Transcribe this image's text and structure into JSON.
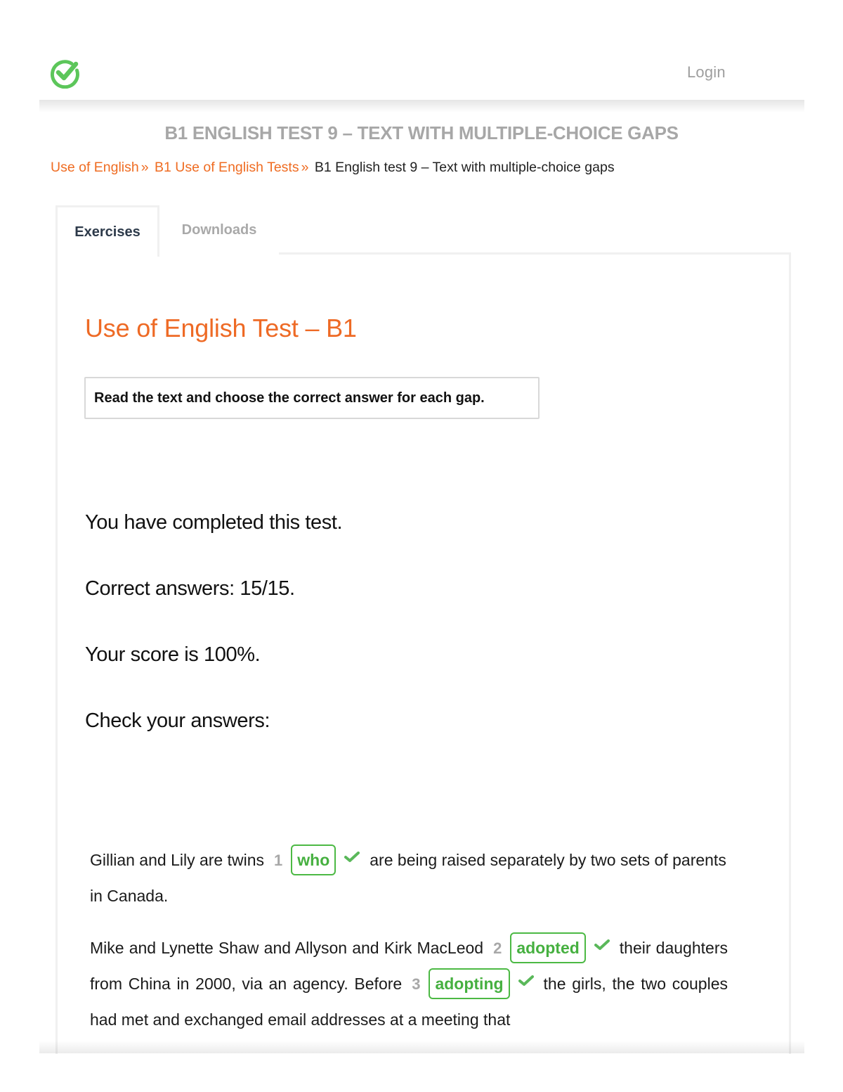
{
  "header": {
    "logo_icon": "check-circle-icon",
    "login_label": "Login",
    "brand_color": "#5cc65a"
  },
  "page_title": "B1 ENGLISH TEST 9 – TEXT WITH MULTIPLE-CHOICE GAPS",
  "breadcrumb": {
    "items": [
      {
        "label": "Use of English",
        "link": true
      },
      {
        "label": "B1 Use of English Tests",
        "link": true
      },
      {
        "label": "B1 English test 9 – Text with multiple-choice gaps",
        "link": false
      }
    ],
    "separator": "»"
  },
  "tabs": [
    {
      "label": "Exercises",
      "active": true
    },
    {
      "label": "Downloads",
      "active": false
    }
  ],
  "exercise": {
    "title": "Use of English Test – B1",
    "instructions": "Read the text and choose the correct answer for each gap.",
    "results": {
      "completed": "You have completed this test.",
      "correct_answers": "Correct answers: 15/15.",
      "score": "Your score is 100%.",
      "check_label": "Check your answers:"
    },
    "passage": {
      "p1": {
        "before_1": "Gillian and Lily are twins",
        "gap_1_num": "1",
        "gap_1_answer": "who",
        "after_1": "are being raised separately by two sets of parents in Canada."
      },
      "p2": {
        "before_2": "Mike and Lynette Shaw and Allyson and Kirk MacLeod",
        "gap_2_num": "2",
        "gap_2_answer": "adopted",
        "after_2": "their daughters from China in 2000, via an agency. Before",
        "gap_3_num": "3",
        "gap_3_answer": "adopting",
        "after_3": "the girls, the two couples had met and exchanged email addresses at a meeting that"
      }
    },
    "colors": {
      "accent": "#ee6a25",
      "correct": "#4cb944",
      "gap_number": "#a8a8a8"
    }
  }
}
